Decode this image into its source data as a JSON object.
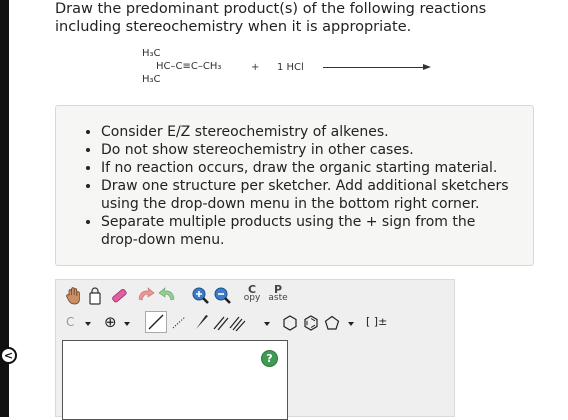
{
  "question": {
    "prompt": "Draw the predominant product(s) of the following reactions including stereochemistry when it is appropriate."
  },
  "reaction": {
    "reactant_top_methyl": "H₃C",
    "reactant_main_chain": "HC–C≡C–CH₃",
    "reactant_bottom_methyl": "H₃C",
    "plus": "+",
    "reagent": "1 HCl"
  },
  "instructions": [
    "Consider E/Z stereochemistry of alkenes.",
    "Do not show stereochemistry in other cases.",
    "If no reaction occurs, draw the organic starting material.",
    "Draw one structure per sketcher. Add additional sketchers using the drop-down menu in the bottom right corner.",
    "Separate multiple products using the + sign from the drop-down menu."
  ],
  "sketcher": {
    "copy_letter": "C",
    "copy_rest": "opy",
    "paste_letter": "P",
    "paste_rest": "aste",
    "element_selected": "C",
    "charge_label": "⊕",
    "bracket_label": "[ ]±",
    "help_label": "?"
  },
  "colors": {
    "help_green": "#3f9b53",
    "panel_bg": "#f6f6f4",
    "toolbar_bg": "#efefef"
  }
}
